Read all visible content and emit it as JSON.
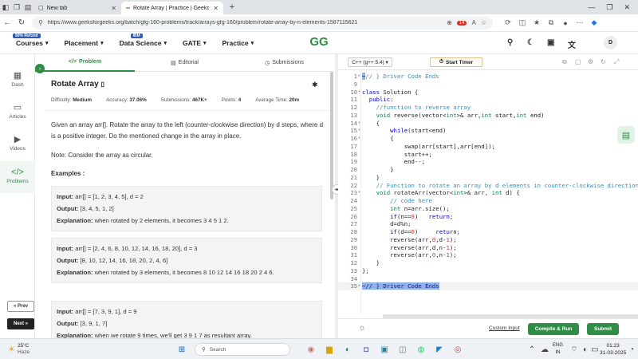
{
  "browser": {
    "tab1_title": "New tab",
    "tab2_title": "Rotate Array | Practice | Geeksfor",
    "url": "https://www.geeksforgeeks.org/batch/gfg-160-problems/track/arrays-gfg-160/problem/rotate-array-by-n-elements-1587115621",
    "notif_count": "14"
  },
  "site": {
    "courses_badge": "90% Refund",
    "courses": "Courses",
    "placement": "Placement",
    "datascience_badge": "IBM",
    "datascience": "Data Science",
    "gate": "GATE",
    "practice": "Practice",
    "logo": "GG",
    "avatar": "D"
  },
  "rail": {
    "dash": "Dash",
    "articles": "Articles",
    "videos": "Videos",
    "problems": "Problems",
    "prev": "« Prev",
    "next": "Next »"
  },
  "tabs": {
    "problem": "Problem",
    "editorial": "Editorial",
    "submissions": "Submissions"
  },
  "problem": {
    "title": "Rotate Array",
    "difficulty_label": "Difficulty:",
    "difficulty": "Medium",
    "accuracy_label": "Accuracy:",
    "accuracy": "37.06%",
    "submissions_label": "Submissions:",
    "submissions": "467K+",
    "points_label": "Points:",
    "points": "4",
    "avgtime_label": "Average Time:",
    "avgtime": "20m",
    "desc1": "Given an array arr[]. Rotate the array to the left (counter-clockwise direction) by d steps, where d is a positive integer. Do the mentioned change in the array in place.",
    "desc2": "Note: Consider the array as circular.",
    "examples_heading": "Examples :",
    "examples": [
      {
        "input": "arr[] = [1, 2, 3, 4, 5], d = 2",
        "output": "[3, 4, 5, 1, 2]",
        "explanation": "when rotated by 2 elements, it becomes 3 4 5 1 2."
      },
      {
        "input": "arr[] = [2, 4, 6, 8, 10, 12, 14, 16, 18, 20], d = 3",
        "output": "[8, 10, 12, 14, 16, 18, 20, 2, 4, 6]",
        "explanation": "when rotated by 3 elements, it becomes 8 10 12 14 16 18 20 2 4 6."
      },
      {
        "input": "arr[] = [7, 3, 9, 1], d = 9",
        "output": "[3, 9, 1, 7]",
        "explanation": "when we rotate 9 times, we'll get 3 9 1 7 as resultant array."
      }
    ],
    "input_label": "Input:",
    "output_label": "Output:",
    "explanation_label": "Explanation:"
  },
  "editor": {
    "language": "C++ (g++ 5.4)",
    "timer": "Start Timer",
    "lines": [
      {
        "n": "1",
        "fold": "▸",
        "html": "<span class=\"sel\">⋯</span><span class=\"cm\">// } Driver Code Ends</span>"
      },
      {
        "n": "9",
        "fold": "",
        "html": ""
      },
      {
        "n": "10",
        "fold": "▾",
        "html": "<span class=\"kw\">class</span> Solution {"
      },
      {
        "n": "11",
        "fold": "",
        "html": "  <span class=\"kw\">public</span>:"
      },
      {
        "n": "12",
        "fold": "",
        "html": "    <span class=\"cm\">//function to reverse array</span>"
      },
      {
        "n": "13",
        "fold": "",
        "html": "    <span class=\"tp\">void</span> reverse(vector&lt;<span class=\"tp\">int</span>&gt;&amp; arr,<span class=\"tp\">int</span> start,<span class=\"tp\">int</span> end)"
      },
      {
        "n": "14",
        "fold": "▾",
        "html": "    {"
      },
      {
        "n": "15",
        "fold": "▾",
        "html": "        <span class=\"kw\">while</span>(start&lt;end)"
      },
      {
        "n": "16",
        "fold": "▾",
        "html": "        {"
      },
      {
        "n": "17",
        "fold": "",
        "html": "            swap(arr[start],arr[end]);"
      },
      {
        "n": "18",
        "fold": "",
        "html": "            start++;"
      },
      {
        "n": "19",
        "fold": "",
        "html": "            end--;"
      },
      {
        "n": "20",
        "fold": "",
        "html": "        }"
      },
      {
        "n": "21",
        "fold": "",
        "html": "    }"
      },
      {
        "n": "22",
        "fold": "",
        "html": "    <span class=\"cm\">// Function to rotate an array by d elements in counter-clockwise direction</span>"
      },
      {
        "n": "23",
        "fold": "▾",
        "html": "    <span class=\"tp\">void</span> rotateArr(vector&lt;<span class=\"tp\">int</span>&gt;&amp; arr, <span class=\"tp\">int</span> d) {"
      },
      {
        "n": "24",
        "fold": "",
        "html": "        <span class=\"cm\">// code here</span>"
      },
      {
        "n": "25",
        "fold": "",
        "html": "        <span class=\"tp\">int</span> n=arr.size();"
      },
      {
        "n": "26",
        "fold": "",
        "html": "        <span class=\"kw\">if</span>(n==<span class=\"nu\">0</span>)   <span class=\"kw\">return</span>;"
      },
      {
        "n": "27",
        "fold": "",
        "html": "        d=d%n;"
      },
      {
        "n": "28",
        "fold": "",
        "html": "        <span class=\"kw\">if</span>(d==<span class=\"nu\">0</span>)     <span class=\"kw\">return</span>;"
      },
      {
        "n": "29",
        "fold": "",
        "html": "        reverse(arr,<span class=\"nu\">0</span>,d-<span class=\"nu\">1</span>);"
      },
      {
        "n": "30",
        "fold": "",
        "html": "        reverse(arr,d,n-<span class=\"nu\">1</span>);"
      },
      {
        "n": "31",
        "fold": "",
        "html": "        reverse(arr,<span class=\"nu\">0</span>,n-<span class=\"nu\">1</span>);"
      },
      {
        "n": "32",
        "fold": "",
        "html": "    }"
      },
      {
        "n": "33",
        "fold": "",
        "html": "};"
      },
      {
        "n": "34",
        "fold": "",
        "html": ""
      },
      {
        "n": "35",
        "fold": "▸",
        "html": "<span class=\"sel\">⋯</span><span class=\"sel\">// } Driver Code Ends</span>"
      }
    ],
    "custom_input": "Custom Input",
    "compile": "Compile & Run",
    "submit": "Submit"
  },
  "taskbar": {
    "temp": "25°C",
    "weather": "Haze",
    "search": "Search",
    "lang1": "ENG",
    "lang2": "IN",
    "time": "01:23",
    "date": "31-03-2025"
  }
}
